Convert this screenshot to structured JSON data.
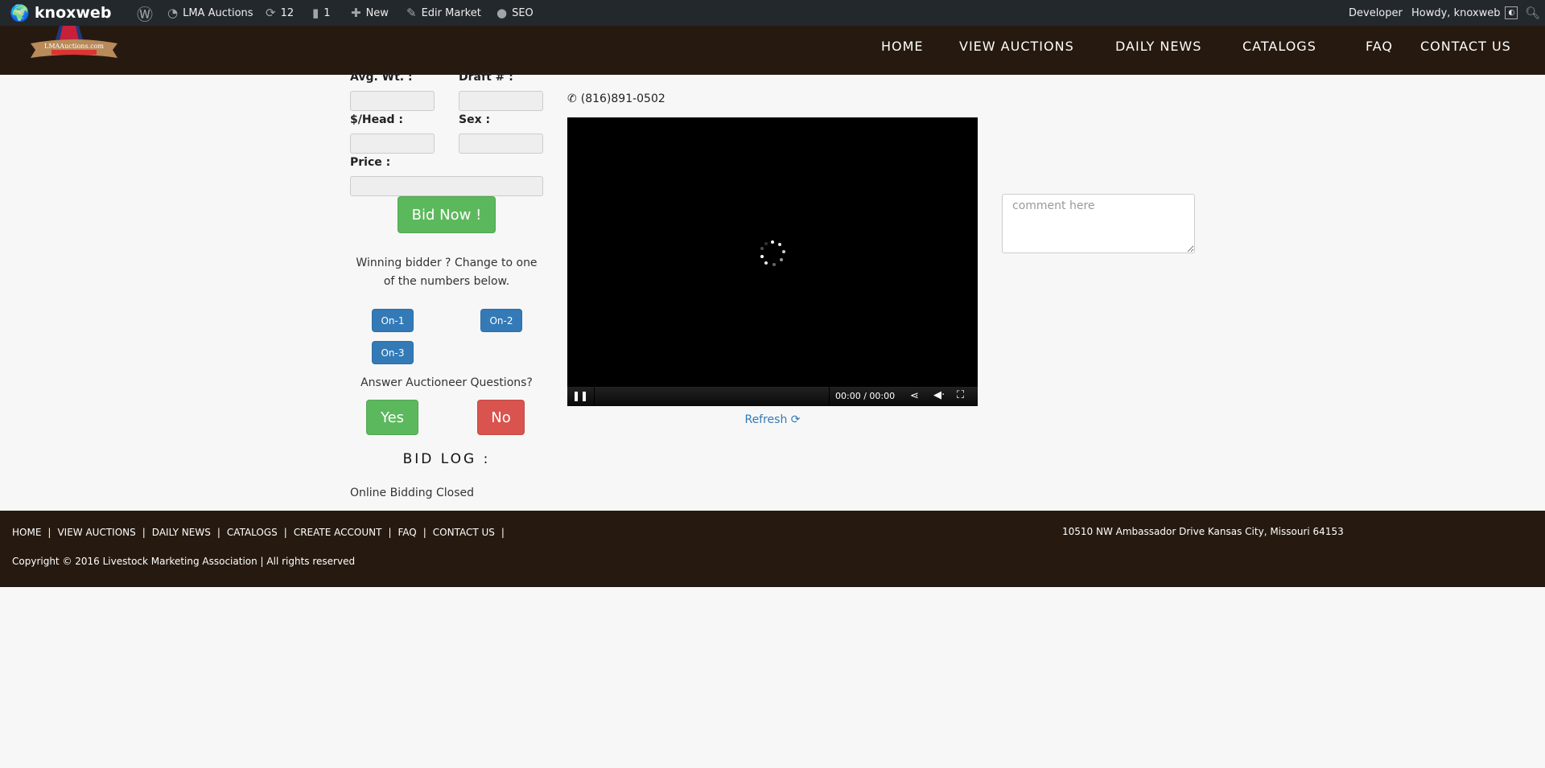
{
  "adminbar": {
    "site": "knoxweb",
    "site_name": "LMA Auctions",
    "updates": "12",
    "comments": "1",
    "new": "New",
    "edit": "Edir Market",
    "seo": "SEO",
    "developer": "Developer",
    "howdy": "Howdy, knoxweb"
  },
  "header": {
    "logo_text": "LMAAuctions.com",
    "nav": [
      "HOME",
      "VIEW AUCTIONS",
      "DAILY NEWS",
      "CATALOGS",
      "FAQ",
      "CONTACT US"
    ]
  },
  "form": {
    "avg_wt": "Avg. Wt. :",
    "draft": "Draft # :",
    "per_head": "$/Head :",
    "sex": "Sex :",
    "price": "Price :",
    "bid_now": "Bid Now !",
    "winning_text": "Winning bidder ? Change to one of the numbers below.",
    "on1": "On-1",
    "on2": "On-2",
    "on3": "On-3",
    "answer": "Answer Auctioneer Questions?",
    "yes": "Yes",
    "no": "No",
    "bid_log": "BID LOG :",
    "status": "Online Bidding Closed"
  },
  "video": {
    "phone": "(816)891-0502",
    "time": "00:00 / 00:00",
    "refresh": "Refresh"
  },
  "comment": {
    "placeholder": "comment here"
  },
  "footer": {
    "links": [
      "HOME",
      "VIEW AUCTIONS",
      "DAILY NEWS",
      "CATALOGS",
      "CREATE ACCOUNT",
      "FAQ",
      "CONTACT US"
    ],
    "copyright": "Copyright © 2016 Livestock Marketing Association | All rights reserved",
    "address": "10510 NW Ambassador Drive Kansas City, Missouri 64153"
  }
}
